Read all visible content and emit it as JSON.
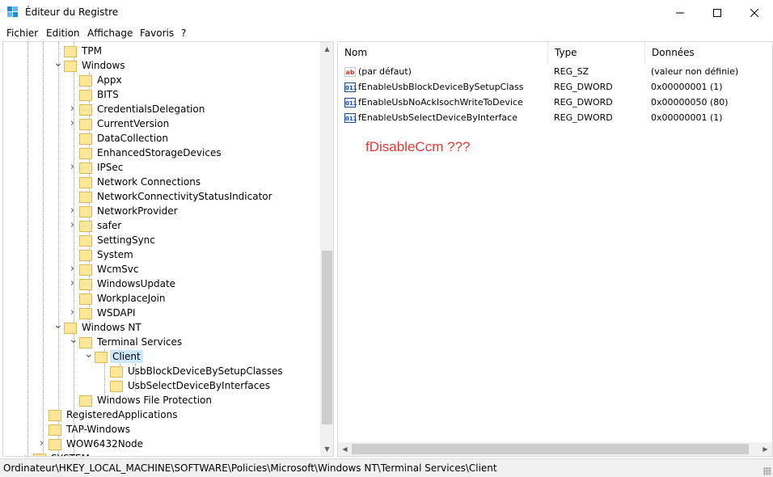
{
  "window": {
    "title": "Éditeur du Registre"
  },
  "menu": [
    "Fichier",
    "Edition",
    "Affichage",
    "Favoris",
    "?"
  ],
  "tree": [
    {
      "label": "TPM",
      "expander": ""
    },
    {
      "label": "Windows",
      "expander": "v"
    },
    {
      "label": "Appx",
      "expander": ""
    },
    {
      "label": "BITS",
      "expander": ""
    },
    {
      "label": "CredentialsDelegation",
      "expander": ">"
    },
    {
      "label": "CurrentVersion",
      "expander": ">"
    },
    {
      "label": "DataCollection",
      "expander": ""
    },
    {
      "label": "EnhancedStorageDevices",
      "expander": ""
    },
    {
      "label": "IPSec",
      "expander": ">"
    },
    {
      "label": "Network Connections",
      "expander": ""
    },
    {
      "label": "NetworkConnectivityStatusIndicator",
      "expander": ""
    },
    {
      "label": "NetworkProvider",
      "expander": ">"
    },
    {
      "label": "safer",
      "expander": ">"
    },
    {
      "label": "SettingSync",
      "expander": ""
    },
    {
      "label": "System",
      "expander": ""
    },
    {
      "label": "WcmSvc",
      "expander": ">"
    },
    {
      "label": "WindowsUpdate",
      "expander": ">"
    },
    {
      "label": "WorkplaceJoin",
      "expander": ""
    },
    {
      "label": "WSDAPI",
      "expander": ">"
    },
    {
      "label": "Windows NT",
      "expander": "v"
    },
    {
      "label": "Terminal Services",
      "expander": "v"
    },
    {
      "label": "Client",
      "expander": "v",
      "selected": true
    },
    {
      "label": "UsbBlockDeviceBySetupClasses",
      "expander": ""
    },
    {
      "label": "UsbSelectDeviceByInterfaces",
      "expander": ""
    },
    {
      "label": "Windows File Protection",
      "expander": ""
    },
    {
      "label": "RegisteredApplications",
      "expander": ""
    },
    {
      "label": "TAP-Windows",
      "expander": ""
    },
    {
      "label": "WOW6432Node",
      "expander": ">"
    },
    {
      "label": "SYSTEM",
      "expander": ">"
    }
  ],
  "list": {
    "columns": [
      "Nom",
      "Type",
      "Données"
    ],
    "rows": [
      {
        "icon": "ab",
        "name": "(par défaut)",
        "type": "REG_SZ",
        "data": "(valeur non définie)"
      },
      {
        "icon": "011",
        "name": "fEnableUsbBlockDeviceBySetupClass",
        "type": "REG_DWORD",
        "data": "0x00000001 (1)"
      },
      {
        "icon": "011",
        "name": "fEnableUsbNoAckIsochWriteToDevice",
        "type": "REG_DWORD",
        "data": "0x00000050 (80)"
      },
      {
        "icon": "011",
        "name": "fEnableUsbSelectDeviceByInterface",
        "type": "REG_DWORD",
        "data": "0x00000001 (1)"
      }
    ],
    "annotation": "fDisableCcm ???"
  },
  "status": {
    "path": "Ordinateur\\HKEY_LOCAL_MACHINE\\SOFTWARE\\Policies\\Microsoft\\Windows NT\\Terminal Services\\Client"
  }
}
